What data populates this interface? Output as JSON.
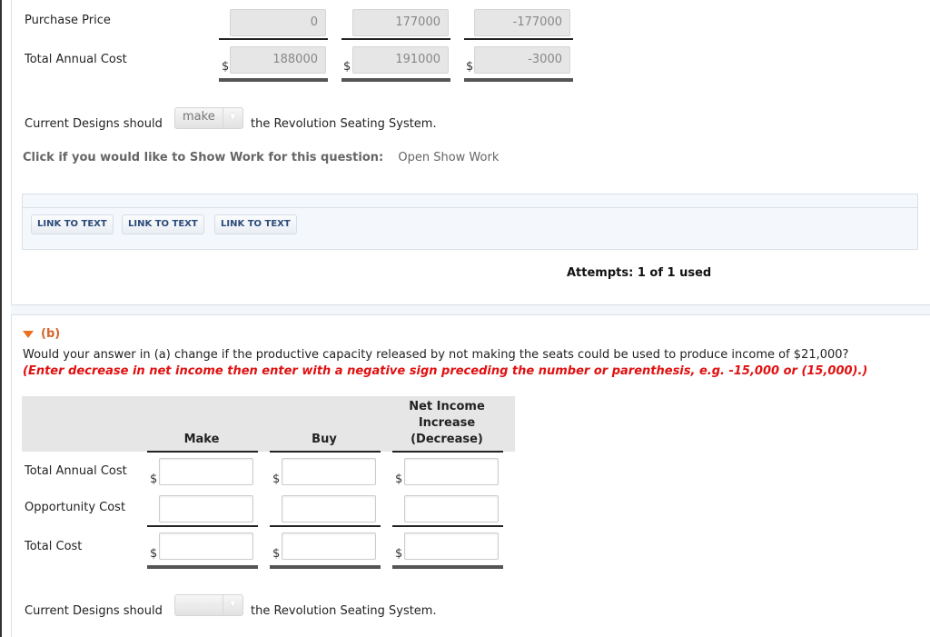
{
  "part_a": {
    "rows": [
      {
        "label": "Purchase Price",
        "values": [
          "0",
          "177000",
          "-177000"
        ],
        "show_dollar": false
      },
      {
        "label": "Total Annual Cost",
        "values": [
          "188000",
          "191000",
          "-3000"
        ],
        "show_dollar": true
      }
    ],
    "currency_symbol": "$",
    "decision": {
      "prefix": "Current Designs should",
      "selected": "make",
      "suffix": "the Revolution Seating System."
    },
    "show_work": {
      "label": "Click if you would like to Show Work for this question:",
      "link": "Open Show Work"
    },
    "link_buttons": [
      "LINK TO TEXT",
      "LINK TO TEXT",
      "LINK TO TEXT"
    ],
    "attempts": "Attempts: 1 of 1 used"
  },
  "part_b": {
    "heading": "(b)",
    "question": "Would your answer in (a) change if the productive capacity released by not making the seats could be used to produce income of $21,000?",
    "instruction": "(Enter decrease in net income then enter with a negative sign preceding the number or parenthesis, e.g. -15,000 or (15,000).)",
    "columns": [
      "Make",
      "Buy",
      "Net Income Increase (Decrease)"
    ],
    "column_lines": [
      "Net Income",
      "Increase",
      "(Decrease)"
    ],
    "rows": [
      {
        "label": "Total Annual Cost",
        "values": [
          "",
          "",
          ""
        ],
        "show_dollar": true
      },
      {
        "label": "Opportunity Cost",
        "values": [
          "",
          "",
          ""
        ],
        "show_dollar": false
      },
      {
        "label": "Total Cost",
        "values": [
          "",
          "",
          ""
        ],
        "show_dollar": true
      }
    ],
    "currency_symbol": "$",
    "decision": {
      "prefix": "Current Designs should",
      "selected": "",
      "suffix": "the Revolution Seating System."
    }
  }
}
